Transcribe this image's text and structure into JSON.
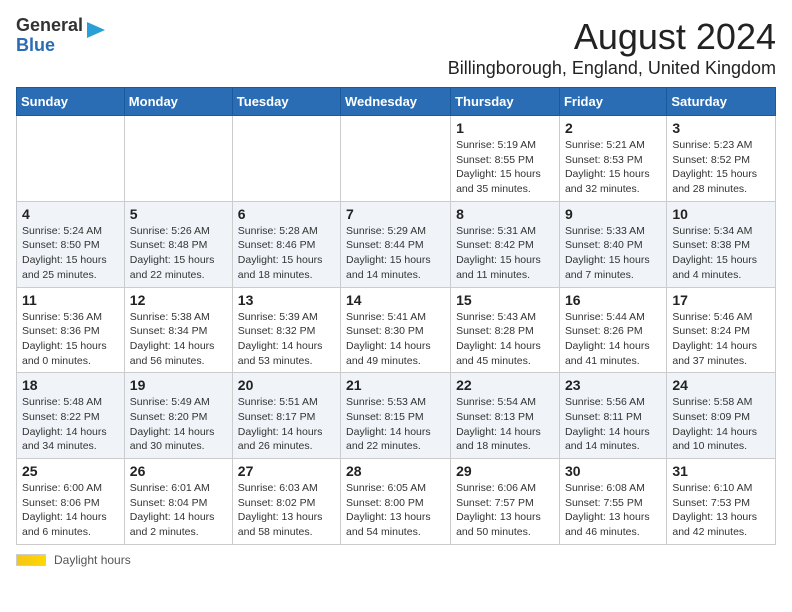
{
  "header": {
    "logo_line1": "General",
    "logo_line2": "Blue",
    "title": "August 2024",
    "subtitle": "Billingborough, England, United Kingdom"
  },
  "calendar": {
    "days_of_week": [
      "Sunday",
      "Monday",
      "Tuesday",
      "Wednesday",
      "Thursday",
      "Friday",
      "Saturday"
    ],
    "weeks": [
      [
        {
          "num": "",
          "info": ""
        },
        {
          "num": "",
          "info": ""
        },
        {
          "num": "",
          "info": ""
        },
        {
          "num": "",
          "info": ""
        },
        {
          "num": "1",
          "info": "Sunrise: 5:19 AM\nSunset: 8:55 PM\nDaylight: 15 hours and 35 minutes."
        },
        {
          "num": "2",
          "info": "Sunrise: 5:21 AM\nSunset: 8:53 PM\nDaylight: 15 hours and 32 minutes."
        },
        {
          "num": "3",
          "info": "Sunrise: 5:23 AM\nSunset: 8:52 PM\nDaylight: 15 hours and 28 minutes."
        }
      ],
      [
        {
          "num": "4",
          "info": "Sunrise: 5:24 AM\nSunset: 8:50 PM\nDaylight: 15 hours and 25 minutes."
        },
        {
          "num": "5",
          "info": "Sunrise: 5:26 AM\nSunset: 8:48 PM\nDaylight: 15 hours and 22 minutes."
        },
        {
          "num": "6",
          "info": "Sunrise: 5:28 AM\nSunset: 8:46 PM\nDaylight: 15 hours and 18 minutes."
        },
        {
          "num": "7",
          "info": "Sunrise: 5:29 AM\nSunset: 8:44 PM\nDaylight: 15 hours and 14 minutes."
        },
        {
          "num": "8",
          "info": "Sunrise: 5:31 AM\nSunset: 8:42 PM\nDaylight: 15 hours and 11 minutes."
        },
        {
          "num": "9",
          "info": "Sunrise: 5:33 AM\nSunset: 8:40 PM\nDaylight: 15 hours and 7 minutes."
        },
        {
          "num": "10",
          "info": "Sunrise: 5:34 AM\nSunset: 8:38 PM\nDaylight: 15 hours and 4 minutes."
        }
      ],
      [
        {
          "num": "11",
          "info": "Sunrise: 5:36 AM\nSunset: 8:36 PM\nDaylight: 15 hours and 0 minutes."
        },
        {
          "num": "12",
          "info": "Sunrise: 5:38 AM\nSunset: 8:34 PM\nDaylight: 14 hours and 56 minutes."
        },
        {
          "num": "13",
          "info": "Sunrise: 5:39 AM\nSunset: 8:32 PM\nDaylight: 14 hours and 53 minutes."
        },
        {
          "num": "14",
          "info": "Sunrise: 5:41 AM\nSunset: 8:30 PM\nDaylight: 14 hours and 49 minutes."
        },
        {
          "num": "15",
          "info": "Sunrise: 5:43 AM\nSunset: 8:28 PM\nDaylight: 14 hours and 45 minutes."
        },
        {
          "num": "16",
          "info": "Sunrise: 5:44 AM\nSunset: 8:26 PM\nDaylight: 14 hours and 41 minutes."
        },
        {
          "num": "17",
          "info": "Sunrise: 5:46 AM\nSunset: 8:24 PM\nDaylight: 14 hours and 37 minutes."
        }
      ],
      [
        {
          "num": "18",
          "info": "Sunrise: 5:48 AM\nSunset: 8:22 PM\nDaylight: 14 hours and 34 minutes."
        },
        {
          "num": "19",
          "info": "Sunrise: 5:49 AM\nSunset: 8:20 PM\nDaylight: 14 hours and 30 minutes."
        },
        {
          "num": "20",
          "info": "Sunrise: 5:51 AM\nSunset: 8:17 PM\nDaylight: 14 hours and 26 minutes."
        },
        {
          "num": "21",
          "info": "Sunrise: 5:53 AM\nSunset: 8:15 PM\nDaylight: 14 hours and 22 minutes."
        },
        {
          "num": "22",
          "info": "Sunrise: 5:54 AM\nSunset: 8:13 PM\nDaylight: 14 hours and 18 minutes."
        },
        {
          "num": "23",
          "info": "Sunrise: 5:56 AM\nSunset: 8:11 PM\nDaylight: 14 hours and 14 minutes."
        },
        {
          "num": "24",
          "info": "Sunrise: 5:58 AM\nSunset: 8:09 PM\nDaylight: 14 hours and 10 minutes."
        }
      ],
      [
        {
          "num": "25",
          "info": "Sunrise: 6:00 AM\nSunset: 8:06 PM\nDaylight: 14 hours and 6 minutes."
        },
        {
          "num": "26",
          "info": "Sunrise: 6:01 AM\nSunset: 8:04 PM\nDaylight: 14 hours and 2 minutes."
        },
        {
          "num": "27",
          "info": "Sunrise: 6:03 AM\nSunset: 8:02 PM\nDaylight: 13 hours and 58 minutes."
        },
        {
          "num": "28",
          "info": "Sunrise: 6:05 AM\nSunset: 8:00 PM\nDaylight: 13 hours and 54 minutes."
        },
        {
          "num": "29",
          "info": "Sunrise: 6:06 AM\nSunset: 7:57 PM\nDaylight: 13 hours and 50 minutes."
        },
        {
          "num": "30",
          "info": "Sunrise: 6:08 AM\nSunset: 7:55 PM\nDaylight: 13 hours and 46 minutes."
        },
        {
          "num": "31",
          "info": "Sunrise: 6:10 AM\nSunset: 7:53 PM\nDaylight: 13 hours and 42 minutes."
        }
      ]
    ]
  },
  "footer": {
    "daylight_label": "Daylight hours"
  }
}
